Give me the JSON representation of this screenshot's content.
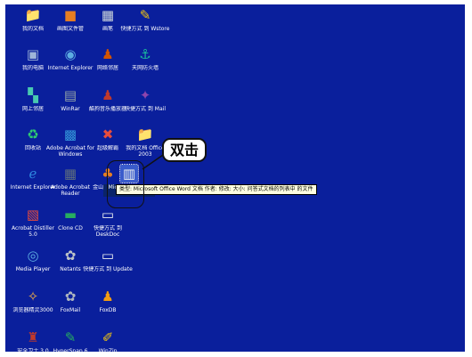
{
  "desktop": {
    "background_color": "#0a1f9c",
    "icons": [
      {
        "name": "my-documents",
        "label": "我的文档",
        "glyph": "📁",
        "color": "#f2c94c"
      },
      {
        "name": "photoshop",
        "label": "画图文件管",
        "glyph": "■",
        "color": "#e67e22"
      },
      {
        "name": "notepad",
        "label": "画笔",
        "glyph": "▦",
        "color": "#cfd8dc"
      },
      {
        "name": "tool-shortcut-1",
        "label": "快捷方式 到 Wstore",
        "glyph": "✎",
        "color": "#f1c40f"
      },
      {
        "name": "my-computer",
        "label": "我的电脑",
        "glyph": "▣",
        "color": "#9fb6d8"
      },
      {
        "name": "internet",
        "label": "Internet Explorer",
        "glyph": "◉",
        "color": "#5dade2"
      },
      {
        "name": "user-folder",
        "label": "网络邻居",
        "glyph": "♟",
        "color": "#d35400"
      },
      {
        "name": "app-shortcut-2",
        "label": "天网防火墙",
        "glyph": "⚓",
        "color": "#1abc9c"
      },
      {
        "name": "network",
        "label": "网上邻居",
        "glyph": "▚",
        "color": "#48c9b0"
      },
      {
        "name": "winrar",
        "label": "WinRar",
        "glyph": "▤",
        "color": "#95a5a6"
      },
      {
        "name": "media-tool",
        "label": "酷狗音乐播放器",
        "glyph": "♟",
        "color": "#c0392b"
      },
      {
        "name": "app-shortcut-3",
        "label": "快捷方式 到 Mail",
        "glyph": "✦",
        "color": "#8e44ad"
      },
      {
        "name": "recycle-bin",
        "label": "回收站",
        "glyph": "♻",
        "color": "#2ecc71"
      },
      {
        "name": "adobe-reader",
        "label": "Adobe Acrobat for Windows",
        "glyph": "▩",
        "color": "#3498db"
      },
      {
        "name": "app-tool-4",
        "label": "超级解霸",
        "glyph": "✖",
        "color": "#e74c3c"
      },
      {
        "name": "office-folder",
        "label": "我的文档 Office 2003",
        "glyph": "📁",
        "color": "#f4d03f"
      },
      {
        "name": "browser-2",
        "label": "Internet Explorer",
        "glyph": "ℯ",
        "color": "#2e86de"
      },
      {
        "name": "adobe-2",
        "label": "Adobe Acrobat Reader",
        "glyph": "▦",
        "color": "#5d6d7e"
      },
      {
        "name": "app-tool-5",
        "label": "金山快译 V3",
        "glyph": "♣",
        "color": "#e67e22"
      },
      {
        "name": "selected-file",
        "label": "Microsoft Office Word",
        "glyph": "▥",
        "color": "#ecf0f1"
      },
      {
        "name": "app-tool-6",
        "label": "Acrobat Distiller 5.0",
        "glyph": "▧",
        "color": "#e74c3c"
      },
      {
        "name": "clone-tool",
        "label": "Clone CD",
        "glyph": "▬",
        "color": "#27ae60"
      },
      {
        "name": "app-shortcut-7",
        "label": "快捷方式 到 DeskDoc",
        "glyph": "▭",
        "color": "#ecf0f1"
      },
      {
        "name": "media-player",
        "label": "Media Player",
        "glyph": "◎",
        "color": "#5dade2"
      },
      {
        "name": "tool-8",
        "label": "Netants",
        "glyph": "✿",
        "color": "#bdc3c7"
      },
      {
        "name": "app-shortcut-9",
        "label": "快捷方式 到 Update",
        "glyph": "▭",
        "color": "#ecf0f1"
      },
      {
        "name": "app-tool-10",
        "label": "浏览器精灵3000",
        "glyph": "✧",
        "color": "#f5b041"
      },
      {
        "name": "forecast",
        "label": "FoxMail",
        "glyph": "✿",
        "color": "#aeb6bf"
      },
      {
        "name": "foxit",
        "label": "FoxDB",
        "glyph": "♟",
        "color": "#f39c12"
      },
      {
        "name": "app-tool-11",
        "label": "安全卫士 3.0",
        "glyph": "♜",
        "color": "#c0392b"
      },
      {
        "name": "app-tool-12",
        "label": "HyperSnap 6",
        "glyph": "✎",
        "color": "#27ae60"
      },
      {
        "name": "app-tool-13",
        "label": "WinZip",
        "glyph": "✐",
        "color": "#f1c40f"
      }
    ]
  },
  "tooltip": {
    "text": "类型: Microsoft Office Word 文档 作者: 修改: 大小: 问答式文档的列表中 的文件"
  },
  "callout": {
    "text": "双击"
  }
}
